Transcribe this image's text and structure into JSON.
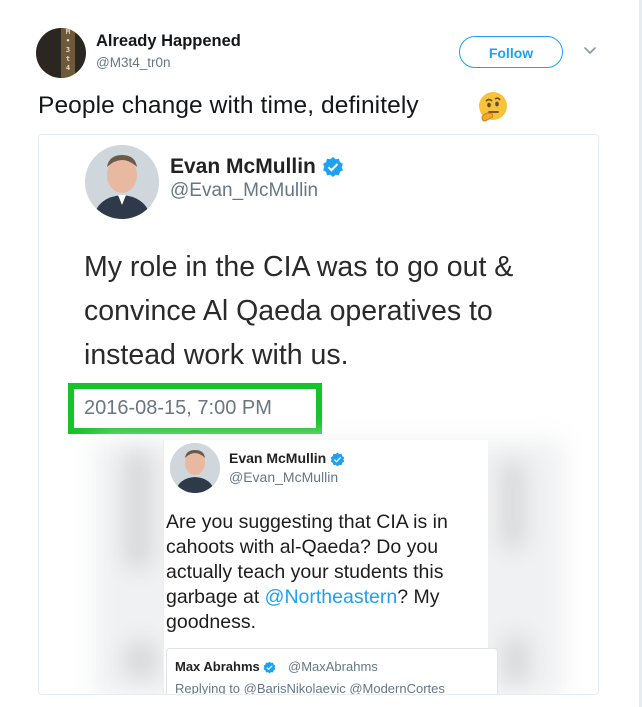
{
  "tweet": {
    "author_name": "Already Happened",
    "author_handle": "@M3t4_tr0n",
    "follow_label": "Follow",
    "text": "People change with time, definitely",
    "emoji": "thinking-face-emoji"
  },
  "media": {
    "screenshot_tweet": {
      "name": "Evan McMullin",
      "handle": "@Evan_McMullin",
      "text_lines": [
        "My role in the CIA was to go out &",
        "convince Al Qaeda operatives to",
        "instead work with us."
      ],
      "timestamp": "2016-08-15, 7:00 PM",
      "highlight_color": "#17c32b"
    },
    "reply_tweet": {
      "name": "Evan McMullin",
      "handle": "@Evan_McMullin",
      "text_before_mention": "Are you suggesting that CIA is in cahoots with al-Qaeda? Do you actually teach your students this garbage at ",
      "mention": "@Northeastern",
      "text_after_mention": "? My goodness."
    },
    "quoted_tweet": {
      "name": "Max Abrahms",
      "handle": "@MaxAbrahms",
      "replying_to": "Replying to @BarisNikolaevic @ModernCortes"
    }
  },
  "colors": {
    "accent": "#1da1f2",
    "verified": "#1da1f2",
    "muted_text": "#657786"
  }
}
